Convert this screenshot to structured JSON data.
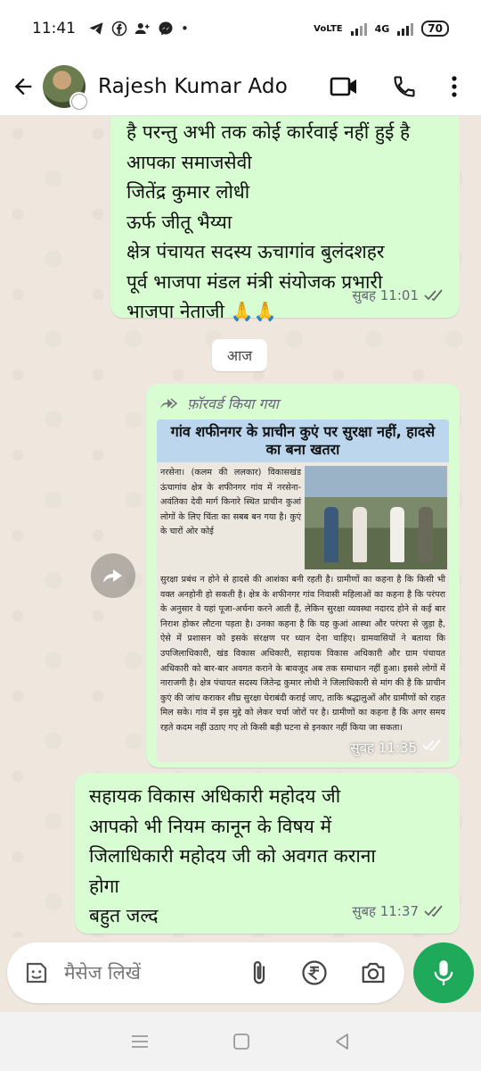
{
  "status_bar": {
    "time": "11:41",
    "battery": "70",
    "network": "VoLTE",
    "signal_label": "4G"
  },
  "header": {
    "contact_name": "Rajesh Kumar Ado"
  },
  "messages": [
    {
      "lines": [
        "है परन्तु अभी तक कोई कार्रवाई नहीं हुई है",
        "आपका समाजसेवी",
        "जितेंद्र कुमार लोधी",
        "ऊर्फ जीतू भैय्या",
        "क्षेत्र पंचायत सदस्य ऊचागांव बुलंदशहर",
        "पूर्व भाजपा मंडल मंत्री संयोजक  प्रभारी",
        "भाजपा नेताजी 🙏🙏"
      ],
      "time": "सुबह 11:01"
    },
    {
      "forwarded_label": "फ़ॉरवर्ड किया गया",
      "image_headline": "गांव शफीनगर के प्राचीन कुएं पर सुरक्षा नहीं, हादसे का बना खतरा",
      "image_column": "नरसेना। (कलम की ललकार) विकासखंड ऊंचागांव क्षेत्र के शफीनगर गांव में नरसेना-अवंतिका देवी मार्ग किनारे स्थित प्राचीन कुआं लोगों के लिए चिंता का सबब बन गया है। कुएं के चारों ओर कोई",
      "image_body": "सुरक्षा प्रबंध न होने से हादसे की आशंका बनी रहती है। ग्रामीणों का कहना है कि किसी भी वक्त अनहोनी हो सकती है। क्षेत्र के शफीनगर गांव निवासी महिलाओं का कहना है कि परंपरा के अनुसार वे यहां पूजा-अर्चना करने आती हैं, लेकिन सुरक्षा व्यवस्था नदारद होने से कई बार निराश होकर लौटना पड़ता है। उनका कहना है कि यह कुआं आस्था और परंपरा से जुड़ा है, ऐसे में प्रशासन को इसके संरक्षण पर ध्यान देना चाहिए। ग्रामवासियों ने बताया कि उपजिलाधिकारी, खंड विकास अधिकारी, सहायक विकास अधिकारी और ग्राम पंचायत अधिकारी को बार-बार अवगत कराने के बावजूद अब तक समाधान नहीं हुआ। इससे लोगों में नाराजगी है। क्षेत्र पंचायत सदस्य जितेन्द्र कुमार लोधी ने जिलाधिकारी से मांग की है कि प्राचीन कुएं की जांच कराकर शीघ्र सुरक्षा घेराबंदी कराई जाए, ताकि श्रद्धालुओं और ग्रामीणों को राहत मिल सके। गांव में इस मुद्दे को लेकर चर्चा जोरों पर है। ग्रामीणों का कहना है कि अगर समय रहते कदम नहीं उठाए गए तो किसी बड़ी घटना से इनकार नहीं किया जा सकता।",
      "time": "सुबह 11:35"
    },
    {
      "lines": [
        "सहायक विकास अधिकारी महोदय जी",
        "आपको भी नियम कानून के विषय में",
        "जिलाधिकारी महोदय जी को अवगत कराना",
        "होगा",
        "बहुत जल्द"
      ],
      "time": "सुबह 11:37"
    }
  ],
  "date_chip": "आज",
  "input": {
    "placeholder": "मैसेज लिखें"
  },
  "colors": {
    "outgoing_bubble": "#d9fdd3",
    "chat_bg": "#efe7dd",
    "mic_button": "#1eaa5a"
  }
}
